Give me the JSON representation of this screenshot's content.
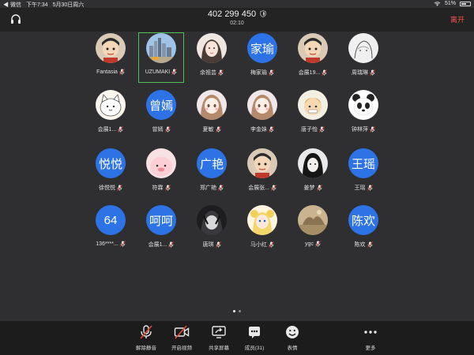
{
  "statusbar": {
    "carrier": "◀ 微信",
    "time": "下午7:34",
    "date": "5月30日周六",
    "battery_text": "51%",
    "battery_level": 0.51
  },
  "header": {
    "meeting_id": "402 299 450",
    "timer": "02:10",
    "leave_label": "离开"
  },
  "colors": {
    "background": "#2f2f31",
    "header": "#232324",
    "toolbar": "#1c1c1d",
    "avatar_blue": "#2e73e6",
    "leave": "#f2554b",
    "active_border": "#4fc152",
    "muted_mic": "#e8463b"
  },
  "participants": [
    {
      "name": "Fantasia",
      "avatar": "image",
      "icon": "cartoon-boy-avatar"
    },
    {
      "name": "UZUMAKI",
      "avatar": "image",
      "icon": "city-skyline-avatar",
      "active": true
    },
    {
      "name": "余祖芸",
      "avatar": "image",
      "icon": "girl-photo-avatar"
    },
    {
      "name": "梅家瑜",
      "avatar": "text",
      "avatar_text": "家瑜"
    },
    {
      "name": "会展19...",
      "avatar": "image",
      "icon": "cartoon-boy-avatar"
    },
    {
      "name": "周瑞琳",
      "avatar": "image",
      "icon": "sketch-avatar"
    },
    {
      "name": "会展1...",
      "avatar": "image",
      "icon": "cartoon-cat-avatar"
    },
    {
      "name": "曾嫣",
      "avatar": "text",
      "avatar_text": "曾嫣"
    },
    {
      "name": "夏敏",
      "avatar": "image",
      "icon": "anime-girl-avatar"
    },
    {
      "name": "李金妹",
      "avatar": "image",
      "icon": "anime-girl-avatar"
    },
    {
      "name": "唐子怡",
      "avatar": "image",
      "icon": "cartoon-avatar"
    },
    {
      "name": "钟林萍",
      "avatar": "image",
      "icon": "panda-avatar"
    },
    {
      "name": "徐悦悦",
      "avatar": "text",
      "avatar_text": "悦悦"
    },
    {
      "name": "符霖",
      "avatar": "image",
      "icon": "pink-cartoon-avatar"
    },
    {
      "name": "郑广艳",
      "avatar": "text",
      "avatar_text": "广艳"
    },
    {
      "name": "会展张...",
      "avatar": "image",
      "icon": "cartoon-boy-avatar"
    },
    {
      "name": "姜梦",
      "avatar": "image",
      "icon": "dark-girl-avatar"
    },
    {
      "name": "王瑶",
      "avatar": "text",
      "avatar_text": "王瑶"
    },
    {
      "name": "136****...",
      "avatar": "text",
      "avatar_text": "64"
    },
    {
      "name": "会展1...",
      "avatar": "text",
      "avatar_text": "呵呵"
    },
    {
      "name": "唐琪",
      "avatar": "image",
      "icon": "dark-anime-avatar"
    },
    {
      "name": "马小红",
      "avatar": "image",
      "icon": "sailor-moon-avatar"
    },
    {
      "name": "ygc",
      "avatar": "image",
      "icon": "painting-avatar"
    },
    {
      "name": "陈欢",
      "avatar": "text",
      "avatar_text": "陈欢"
    }
  ],
  "pager": {
    "pages": 2,
    "current": 1
  },
  "toolbar": [
    {
      "label": "解除静音",
      "icon": "muted-mic-icon"
    },
    {
      "label": "开启视频",
      "icon": "video-off-icon"
    },
    {
      "label": "共享屏幕",
      "icon": "share-screen-icon"
    },
    {
      "label": "成员(31)",
      "icon": "members-icon"
    },
    {
      "label": "表情",
      "icon": "emoji-icon"
    },
    {
      "label": "更多",
      "icon": "more-icon"
    }
  ]
}
